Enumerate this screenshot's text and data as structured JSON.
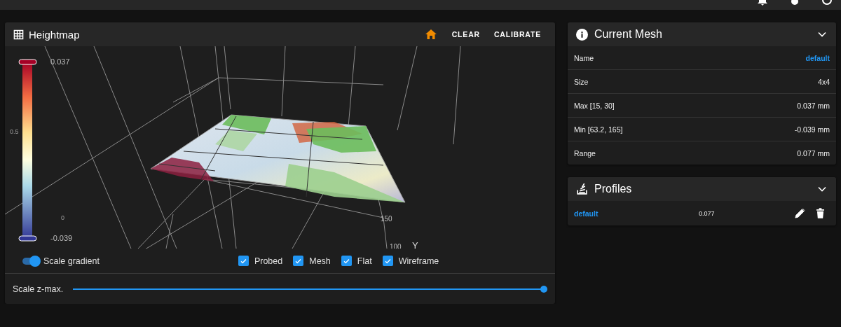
{
  "heightmap": {
    "title": "Heightmap",
    "actions": [
      {
        "label": "CLEAR"
      },
      {
        "label": "CALIBRATE"
      }
    ],
    "scale_labels": [
      "0.037",
      "0.5",
      "0",
      "-0.039"
    ],
    "axis_labels": [
      "150",
      "100",
      "Y"
    ],
    "toggle": {
      "label": "Scale gradient",
      "on": true
    },
    "checkboxes": [
      {
        "label": "Probed",
        "checked": true
      },
      {
        "label": "Mesh",
        "checked": true
      },
      {
        "label": "Flat",
        "checked": true
      },
      {
        "label": "Wireframe",
        "checked": true
      }
    ],
    "zmax_slider": {
      "label": "Scale z-max.",
      "level": 1
    }
  },
  "current_mesh": {
    "title": "Current Mesh",
    "expanded": true,
    "rows": [
      {
        "label": "Name",
        "value": "default",
        "kind": "link"
      },
      {
        "label": "Size",
        "value": "4x4",
        "kind": "text"
      },
      {
        "label": "Max [15, 30]",
        "value": "0.037 mm",
        "kind": "text"
      },
      {
        "label": "Min [63.2, 165]",
        "value": "-0.039 mm",
        "kind": "text"
      },
      {
        "label": "Range",
        "value": "0.077 mm",
        "kind": "text"
      }
    ]
  },
  "profiles": {
    "title": "Profiles",
    "expanded": true,
    "items": [
      {
        "name": "default",
        "range": "0.077"
      }
    ]
  }
}
